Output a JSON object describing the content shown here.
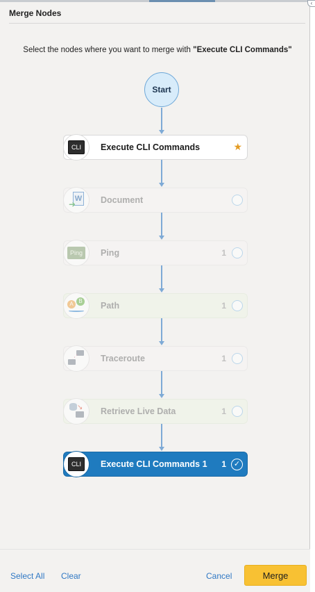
{
  "dialog": {
    "title": "Merge Nodes",
    "instruction_prefix": "Select the nodes where you want to merge with ",
    "instruction_target": "\"Execute CLI Commands\""
  },
  "flow": {
    "start_label": "Start",
    "nodes": [
      {
        "label": "Execute CLI Commands",
        "icon": "cli-icon",
        "icon_text": "CLI",
        "count": "",
        "state": "source",
        "marker": "star-icon"
      },
      {
        "label": "Document",
        "icon": "word-document-icon",
        "icon_text": "W",
        "count": "",
        "state": "disabled",
        "marker": "radio"
      },
      {
        "label": "Ping",
        "icon": "ping-icon",
        "icon_text": "Ping",
        "count": "1",
        "state": "disabled",
        "marker": "radio"
      },
      {
        "label": "Path",
        "icon": "path-icon",
        "icon_text": "A B",
        "count": "1",
        "state": "disabled",
        "marker": "radio"
      },
      {
        "label": "Traceroute",
        "icon": "traceroute-icon",
        "icon_text": "",
        "count": "1",
        "state": "disabled",
        "marker": "radio"
      },
      {
        "label": "Retrieve Live Data",
        "icon": "live-data-icon",
        "icon_text": "",
        "count": "1",
        "state": "disabled",
        "marker": "radio"
      },
      {
        "label": "Execute CLI Commands 1",
        "icon": "cli-icon",
        "icon_text": "CLI",
        "count": "1",
        "state": "selected",
        "marker": "check-icon"
      }
    ]
  },
  "footer": {
    "select_all": "Select All",
    "clear": "Clear",
    "cancel": "Cancel",
    "merge": "Merge"
  },
  "colors": {
    "accent": "#1f7bbf",
    "merge_button": "#f8c133",
    "link": "#2f78c4",
    "connector": "#7eaad6"
  }
}
